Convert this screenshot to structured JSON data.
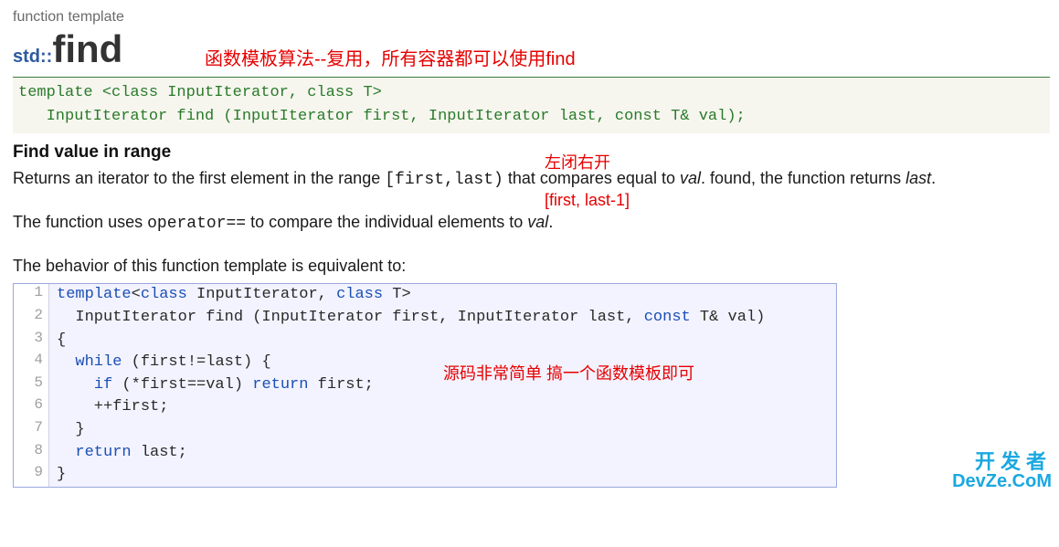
{
  "category": "function template",
  "title": {
    "ns": "std::",
    "fn": "find"
  },
  "annotations": {
    "title_right": "函数模板算法--复用，所有容器都可以使用find",
    "range_note": "左闭右开",
    "range_bracket": "[first, last-1]",
    "source_note": "源码非常简单 搞一个函数模板即可"
  },
  "signature": "template <class InputIterator, class T>\n   InputIterator find (InputIterator first, InputIterator last, const T& val);",
  "subhead": "Find value in range",
  "desc": {
    "p1_a": "Returns an iterator to the first element in the range ",
    "p1_range": "[first,last)",
    "p1_b": " that compares equal to ",
    "p1_val": "val",
    "p1_c": ". found, the function returns ",
    "p1_last": "last",
    "p1_d": ".",
    "p2_a": "The function uses ",
    "p2_op": "operator==",
    "p2_b": " to compare the individual elements to ",
    "p2_val": "val",
    "p2_c": ".",
    "p3": "The behavior of this function template is equivalent to:"
  },
  "code": {
    "lines": [
      {
        "n": "1",
        "tokens": [
          {
            "t": "template",
            "c": "kw"
          },
          {
            "t": "<"
          },
          {
            "t": "class",
            "c": "kw"
          },
          {
            "t": " InputIterator, "
          },
          {
            "t": "class",
            "c": "kw"
          },
          {
            "t": " T>"
          }
        ]
      },
      {
        "n": "2",
        "tokens": [
          {
            "t": "  InputIterator find (InputIterator first, InputIterator last, "
          },
          {
            "t": "const",
            "c": "kw"
          },
          {
            "t": " T& val)"
          }
        ]
      },
      {
        "n": "3",
        "tokens": [
          {
            "t": "{"
          }
        ]
      },
      {
        "n": "4",
        "tokens": [
          {
            "t": "  "
          },
          {
            "t": "while",
            "c": "kw"
          },
          {
            "t": " (first!=last) {"
          }
        ]
      },
      {
        "n": "5",
        "tokens": [
          {
            "t": "    "
          },
          {
            "t": "if",
            "c": "kw"
          },
          {
            "t": " (*first==val) "
          },
          {
            "t": "return",
            "c": "kw"
          },
          {
            "t": " first;"
          }
        ]
      },
      {
        "n": "6",
        "tokens": [
          {
            "t": "    ++first;"
          }
        ]
      },
      {
        "n": "7",
        "tokens": [
          {
            "t": "  }"
          }
        ]
      },
      {
        "n": "8",
        "tokens": [
          {
            "t": "  "
          },
          {
            "t": "return",
            "c": "kw"
          },
          {
            "t": " last;"
          }
        ]
      },
      {
        "n": "9",
        "tokens": [
          {
            "t": "}"
          }
        ]
      }
    ]
  },
  "watermark": {
    "line1": "开发者",
    "line2": "DevZe.CoM"
  }
}
